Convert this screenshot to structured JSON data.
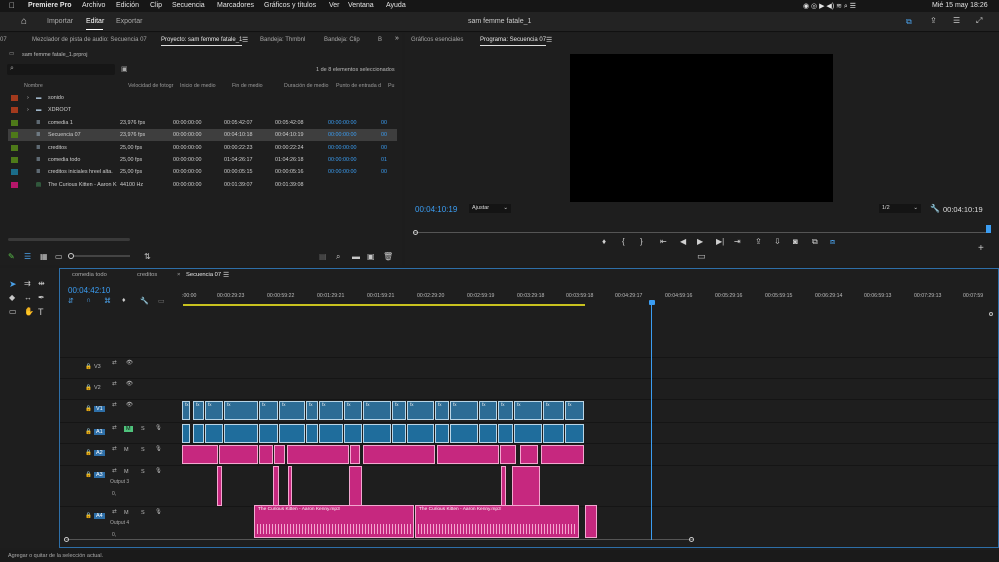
{
  "menubar": {
    "apple": "",
    "app_name": "Premiere Pro",
    "items": [
      "Archivo",
      "Edición",
      "Clip",
      "Secuencia",
      "Marcadores",
      "Gráficos y títulos",
      "Ver",
      "Ventana",
      "Ayuda"
    ],
    "clock": "Mié 15 may  18:26"
  },
  "appbar": {
    "tabs": [
      "Importar",
      "Editar",
      "Exportar"
    ],
    "active_tab": "Editar",
    "title": "sam femme fatale_1"
  },
  "project_panel": {
    "tabs": [
      "07",
      "Mezclador de pista de audio: Secuencia 07",
      "Proyecto: sam femme fatale_1",
      "Bandeja: Thmbnl",
      "Bandeja: Clip",
      "B"
    ],
    "file": "sam femme fatale_1.prproj",
    "selection_info": "1 de 8 elementos seleccionados",
    "columns": [
      "Nombre",
      "Velocidad de fotogr",
      "Inicio de medio",
      "Fin de medio",
      "Duración de medio",
      "Punto de entrada d",
      "Pu"
    ],
    "rows": [
      {
        "name": "sonido",
        "fps": "",
        "start": "",
        "end": "",
        "dur": "",
        "in": "",
        "p": "",
        "color": "#a33a1d",
        "type": "folder"
      },
      {
        "name": "XDROOT",
        "fps": "",
        "start": "",
        "end": "",
        "dur": "",
        "in": "",
        "p": "",
        "color": "#a33a1d",
        "type": "folder"
      },
      {
        "name": "comedia 1",
        "fps": "23,976 fps",
        "start": "00:00:00:00",
        "end": "00:05:42:07",
        "dur": "00:05:42:08",
        "in": "00:00:00:00",
        "p": "00",
        "color": "#4e7a19",
        "type": "sequence"
      },
      {
        "name": "Secuencia 07",
        "fps": "23,976 fps",
        "start": "00:00:00:00",
        "end": "00:04:10:18",
        "dur": "00:04:10:19",
        "in": "00:00:00:00",
        "p": "00",
        "color": "#4e7a19",
        "type": "sequence"
      },
      {
        "name": "creditos",
        "fps": "25,00 fps",
        "start": "00:00:00:00",
        "end": "00:00:22:23",
        "dur": "00:00:22:24",
        "in": "00:00:00:00",
        "p": "00",
        "color": "#4e7a19",
        "type": "sequence"
      },
      {
        "name": "comedia todo",
        "fps": "25,00 fps",
        "start": "00:00:00:00",
        "end": "01:04:26:17",
        "dur": "01:04:26:18",
        "in": "00:00:00:00",
        "p": "01",
        "color": "#4e7a19",
        "type": "sequence"
      },
      {
        "name": "creditos iniciales hreel alta.",
        "fps": "25,00 fps",
        "start": "00:00:00:00",
        "end": "00:00:05:15",
        "dur": "00:00:05:16",
        "in": "00:00:00:00",
        "p": "00",
        "color": "#1b6d8a",
        "type": "sequence"
      },
      {
        "name": "The Curious Kitten - Aaron K",
        "fps": "44100 Hz",
        "start": "00:00:00:00",
        "end": "00:01:39:07",
        "dur": "00:01:39:08",
        "in": "",
        "p": "",
        "color": "#b5166a",
        "type": "audio"
      }
    ]
  },
  "program_panel": {
    "tabs": [
      "Gráficos esenciales",
      "Programa: Secuencia 07"
    ],
    "timecode": "00:04:10:19",
    "fit": "Ajustar",
    "quality": "1/2",
    "duration": "00:04:10:19"
  },
  "timeline": {
    "tabs": [
      "comedia todo",
      "creditos",
      "Secuencia 07"
    ],
    "timecode": "00:04:42:10",
    "ruler": [
      ":00:00",
      "00:00:29:23",
      "00:00:59:22",
      "00:01:29:21",
      "00:01:59:21",
      "00:02:29:20",
      "00:02:59:19",
      "00:03:29:18",
      "00:03:59:18",
      "00:04:29:17",
      "00:04:59:16",
      "00:05:29:16",
      "00:05:59:15",
      "00:06:29:14",
      "00:06:59:13",
      "00:07:29:13",
      "00:07:59"
    ],
    "tracks": [
      "V3",
      "V2",
      "V1",
      "A1",
      "A2",
      "A3",
      "A4"
    ],
    "track_labels": {
      "mute": "M",
      "solo": "S",
      "output3": "Output 3",
      "output4": "Output 4",
      "vol": "0,"
    },
    "fx": "fx",
    "audio_clip_name": "The Curious Kitten - Aaron Kenny.mp3"
  },
  "status": "Agregar o quitar de la selección actual.",
  "colors": {
    "accent": "#3b9df2",
    "audio_clip": "#c6287f",
    "video_clip": "#2d6c95"
  }
}
